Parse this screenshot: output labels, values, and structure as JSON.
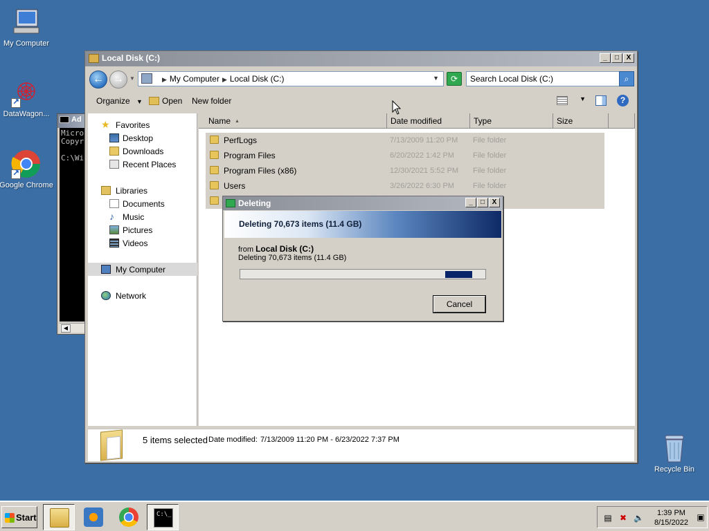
{
  "desktop": {
    "icons": [
      {
        "label": "My Computer"
      },
      {
        "label": "DataWagon..."
      },
      {
        "label": "Google Chrome"
      },
      {
        "label": "Recycle Bin"
      }
    ]
  },
  "cmd_window": {
    "title": "Ad",
    "lines": "Micro\nCopyr\n\nC:\\Wi"
  },
  "explorer": {
    "title": "Local Disk (C:)",
    "address": {
      "segments": [
        "My Computer",
        "Local Disk (C:)"
      ]
    },
    "search_placeholder": "Search Local Disk (C:)",
    "toolbar": {
      "organize": "Organize",
      "open": "Open",
      "new_folder": "New folder"
    },
    "nav": {
      "favorites": "Favorites",
      "desktop": "Desktop",
      "downloads": "Downloads",
      "recent": "Recent Places",
      "libraries": "Libraries",
      "documents": "Documents",
      "music": "Music",
      "pictures": "Pictures",
      "videos": "Videos",
      "my_computer": "My Computer",
      "network": "Network"
    },
    "columns": {
      "name": "Name",
      "date": "Date modified",
      "type": "Type",
      "size": "Size"
    },
    "rows": [
      {
        "name": "PerfLogs",
        "date": "7/13/2009 11:20 PM",
        "type": "File folder"
      },
      {
        "name": "Program Files",
        "date": "6/20/2022 1:42 PM",
        "type": "File folder"
      },
      {
        "name": "Program Files (x86)",
        "date": "12/30/2021 5:52 PM",
        "type": "File folder"
      },
      {
        "name": "Users",
        "date": "3/26/2022 6:30 PM",
        "type": "File folder"
      }
    ],
    "details": {
      "count": "5 items selected",
      "modified_label": "Date modified:",
      "modified_value": "7/13/2009 11:20 PM - 6/23/2022 7:37 PM"
    }
  },
  "dialog": {
    "title": "Deleting",
    "header": "Deleting 70,673 items (11.4 GB)",
    "from_label": "from",
    "from_location": "Local Disk (C:)",
    "status": "Deleting 70,673 items (11.4 GB)",
    "cancel": "Cancel"
  },
  "taskbar": {
    "start": "Start",
    "time": "1:39 PM",
    "date": "8/15/2022"
  },
  "window_buttons": {
    "min": "_",
    "max": "□",
    "close": "X"
  }
}
